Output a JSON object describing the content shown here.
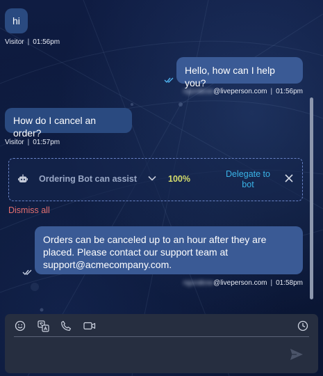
{
  "messages": [
    {
      "role": "visitor",
      "text": "hi",
      "sender": "Visitor",
      "time": "01:56pm"
    },
    {
      "role": "agent",
      "text": "Hello, how can I help you?",
      "sender_blurred": "ngurakow",
      "sender_domain": "@liveperson.com",
      "time": "01:56pm"
    },
    {
      "role": "visitor",
      "text": "How do I cancel an order?",
      "sender": "Visitor",
      "time": "01:57pm"
    },
    {
      "role": "agent",
      "text": "Orders can be canceled up to an hour after they are placed. Please contact our support team at support@acmecompany.com.",
      "sender_blurred": "ngurakow",
      "sender_domain": "@liveperson.com",
      "time": "01:58pm"
    }
  ],
  "separator": "|",
  "suggestion": {
    "bot_name": "Ordering Bot can assist",
    "confidence": "100%",
    "delegate_label": "Delegate to bot",
    "icon": "robot-icon"
  },
  "dismiss_all_label": "Dismiss all",
  "composer": {
    "placeholder": "",
    "toolbar": [
      "emoji-icon",
      "translate-icon",
      "phone-icon",
      "video-icon",
      "clock-icon"
    ],
    "send_icon": "send-icon"
  },
  "colors": {
    "background": "#0e1a3d",
    "visitor_bubble": "#2a4a80",
    "agent_bubble": "#3a5a95",
    "confidence": "#d4dc6c",
    "delegate_link": "#3ab4e8",
    "dismiss": "#e46f6f",
    "composer": "#262e40"
  }
}
